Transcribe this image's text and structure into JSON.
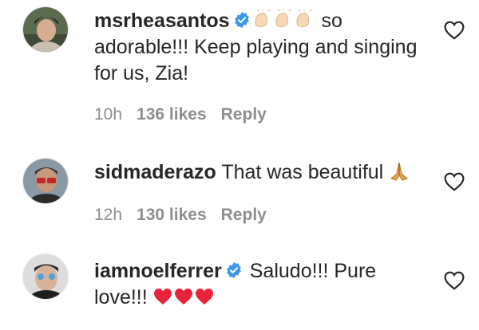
{
  "comments": [
    {
      "username": "msrheasantos",
      "verified": true,
      "emoji_prefix": "👏👏👏",
      "text_line1": "so",
      "text_rest": "adorable!!! Keep playing and singing for us, Zia!",
      "time": "10h",
      "likes": "136 likes",
      "reply": "Reply"
    },
    {
      "username": "sidmaderazo",
      "verified": false,
      "text": "That was beautiful",
      "emoji_suffix": "🙏",
      "time": "12h",
      "likes": "130 likes",
      "reply": "Reply"
    },
    {
      "username": "iamnoelferrer",
      "verified": true,
      "text": "Saludo!!! Pure love!!!",
      "emoji_suffix": "❤❤❤"
    }
  ],
  "icons": {
    "verified": "verified-badge-icon",
    "like": "heart-outline-icon",
    "clap": "clapping-hands-emoji",
    "pray": "folded-hands-emoji",
    "heart_red": "red-heart-emoji"
  },
  "colors": {
    "text": "#262626",
    "meta": "#8e8e8e",
    "verified": "#3897f0",
    "heart_red": "#e8233a"
  }
}
